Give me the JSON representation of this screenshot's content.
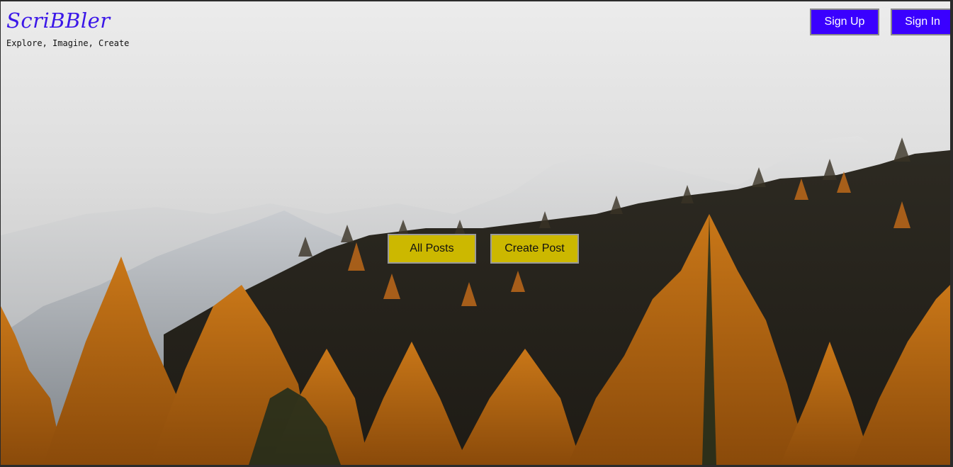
{
  "brand": {
    "logo": "ScriBBler",
    "tagline": "Explore, Imagine, Create"
  },
  "auth": {
    "sign_up_label": "Sign Up",
    "sign_in_label": "Sign In"
  },
  "hero": {
    "all_posts_label": "All Posts",
    "create_post_label": "Create Post",
    "background_image": "autumn-mountain-forest-image"
  },
  "colors": {
    "auth_button": "#3a00ff",
    "action_button": "#ccb800",
    "logo": "#3b17e8"
  }
}
